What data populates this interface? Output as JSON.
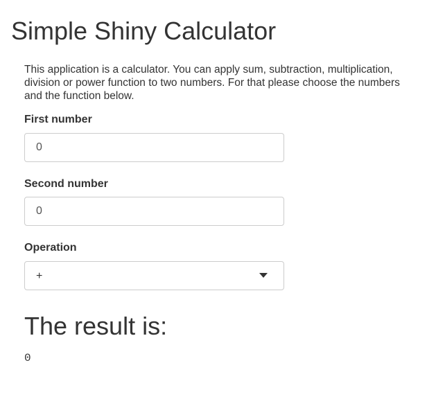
{
  "app": {
    "title": "Simple Shiny Calculator",
    "description": "This application is a calculator. You can apply sum, subtraction, multiplication, division or power function to two numbers. For that please choose the numbers and the function below."
  },
  "form": {
    "first_number": {
      "label": "First number",
      "value": "0"
    },
    "second_number": {
      "label": "Second number",
      "value": "0"
    },
    "operation": {
      "label": "Operation",
      "selected": "+"
    }
  },
  "result": {
    "heading": "The result is:",
    "value": "0"
  },
  "icons": {
    "select_caret": "caret-down-icon"
  }
}
